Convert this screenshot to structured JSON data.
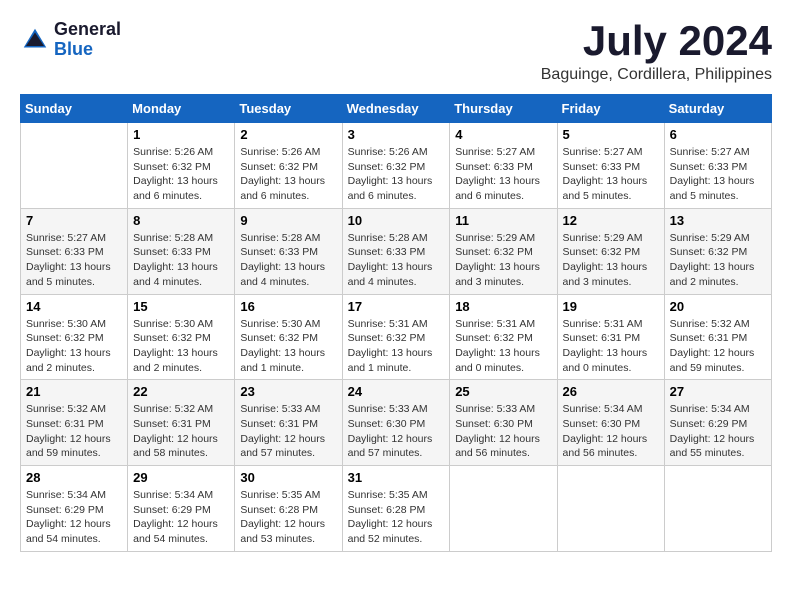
{
  "header": {
    "logo_general": "General",
    "logo_blue": "Blue",
    "month_title": "July 2024",
    "location": "Baguinge, Cordillera, Philippines"
  },
  "weekdays": [
    "Sunday",
    "Monday",
    "Tuesday",
    "Wednesday",
    "Thursday",
    "Friday",
    "Saturday"
  ],
  "weeks": [
    [
      {
        "day": "",
        "info": ""
      },
      {
        "day": "1",
        "info": "Sunrise: 5:26 AM\nSunset: 6:32 PM\nDaylight: 13 hours\nand 6 minutes."
      },
      {
        "day": "2",
        "info": "Sunrise: 5:26 AM\nSunset: 6:32 PM\nDaylight: 13 hours\nand 6 minutes."
      },
      {
        "day": "3",
        "info": "Sunrise: 5:26 AM\nSunset: 6:32 PM\nDaylight: 13 hours\nand 6 minutes."
      },
      {
        "day": "4",
        "info": "Sunrise: 5:27 AM\nSunset: 6:33 PM\nDaylight: 13 hours\nand 6 minutes."
      },
      {
        "day": "5",
        "info": "Sunrise: 5:27 AM\nSunset: 6:33 PM\nDaylight: 13 hours\nand 5 minutes."
      },
      {
        "day": "6",
        "info": "Sunrise: 5:27 AM\nSunset: 6:33 PM\nDaylight: 13 hours\nand 5 minutes."
      }
    ],
    [
      {
        "day": "7",
        "info": "Sunrise: 5:27 AM\nSunset: 6:33 PM\nDaylight: 13 hours\nand 5 minutes."
      },
      {
        "day": "8",
        "info": "Sunrise: 5:28 AM\nSunset: 6:33 PM\nDaylight: 13 hours\nand 4 minutes."
      },
      {
        "day": "9",
        "info": "Sunrise: 5:28 AM\nSunset: 6:33 PM\nDaylight: 13 hours\nand 4 minutes."
      },
      {
        "day": "10",
        "info": "Sunrise: 5:28 AM\nSunset: 6:33 PM\nDaylight: 13 hours\nand 4 minutes."
      },
      {
        "day": "11",
        "info": "Sunrise: 5:29 AM\nSunset: 6:32 PM\nDaylight: 13 hours\nand 3 minutes."
      },
      {
        "day": "12",
        "info": "Sunrise: 5:29 AM\nSunset: 6:32 PM\nDaylight: 13 hours\nand 3 minutes."
      },
      {
        "day": "13",
        "info": "Sunrise: 5:29 AM\nSunset: 6:32 PM\nDaylight: 13 hours\nand 2 minutes."
      }
    ],
    [
      {
        "day": "14",
        "info": "Sunrise: 5:30 AM\nSunset: 6:32 PM\nDaylight: 13 hours\nand 2 minutes."
      },
      {
        "day": "15",
        "info": "Sunrise: 5:30 AM\nSunset: 6:32 PM\nDaylight: 13 hours\nand 2 minutes."
      },
      {
        "day": "16",
        "info": "Sunrise: 5:30 AM\nSunset: 6:32 PM\nDaylight: 13 hours\nand 1 minute."
      },
      {
        "day": "17",
        "info": "Sunrise: 5:31 AM\nSunset: 6:32 PM\nDaylight: 13 hours\nand 1 minute."
      },
      {
        "day": "18",
        "info": "Sunrise: 5:31 AM\nSunset: 6:32 PM\nDaylight: 13 hours\nand 0 minutes."
      },
      {
        "day": "19",
        "info": "Sunrise: 5:31 AM\nSunset: 6:31 PM\nDaylight: 13 hours\nand 0 minutes."
      },
      {
        "day": "20",
        "info": "Sunrise: 5:32 AM\nSunset: 6:31 PM\nDaylight: 12 hours\nand 59 minutes."
      }
    ],
    [
      {
        "day": "21",
        "info": "Sunrise: 5:32 AM\nSunset: 6:31 PM\nDaylight: 12 hours\nand 59 minutes."
      },
      {
        "day": "22",
        "info": "Sunrise: 5:32 AM\nSunset: 6:31 PM\nDaylight: 12 hours\nand 58 minutes."
      },
      {
        "day": "23",
        "info": "Sunrise: 5:33 AM\nSunset: 6:31 PM\nDaylight: 12 hours\nand 57 minutes."
      },
      {
        "day": "24",
        "info": "Sunrise: 5:33 AM\nSunset: 6:30 PM\nDaylight: 12 hours\nand 57 minutes."
      },
      {
        "day": "25",
        "info": "Sunrise: 5:33 AM\nSunset: 6:30 PM\nDaylight: 12 hours\nand 56 minutes."
      },
      {
        "day": "26",
        "info": "Sunrise: 5:34 AM\nSunset: 6:30 PM\nDaylight: 12 hours\nand 56 minutes."
      },
      {
        "day": "27",
        "info": "Sunrise: 5:34 AM\nSunset: 6:29 PM\nDaylight: 12 hours\nand 55 minutes."
      }
    ],
    [
      {
        "day": "28",
        "info": "Sunrise: 5:34 AM\nSunset: 6:29 PM\nDaylight: 12 hours\nand 54 minutes."
      },
      {
        "day": "29",
        "info": "Sunrise: 5:34 AM\nSunset: 6:29 PM\nDaylight: 12 hours\nand 54 minutes."
      },
      {
        "day": "30",
        "info": "Sunrise: 5:35 AM\nSunset: 6:28 PM\nDaylight: 12 hours\nand 53 minutes."
      },
      {
        "day": "31",
        "info": "Sunrise: 5:35 AM\nSunset: 6:28 PM\nDaylight: 12 hours\nand 52 minutes."
      },
      {
        "day": "",
        "info": ""
      },
      {
        "day": "",
        "info": ""
      },
      {
        "day": "",
        "info": ""
      }
    ]
  ]
}
